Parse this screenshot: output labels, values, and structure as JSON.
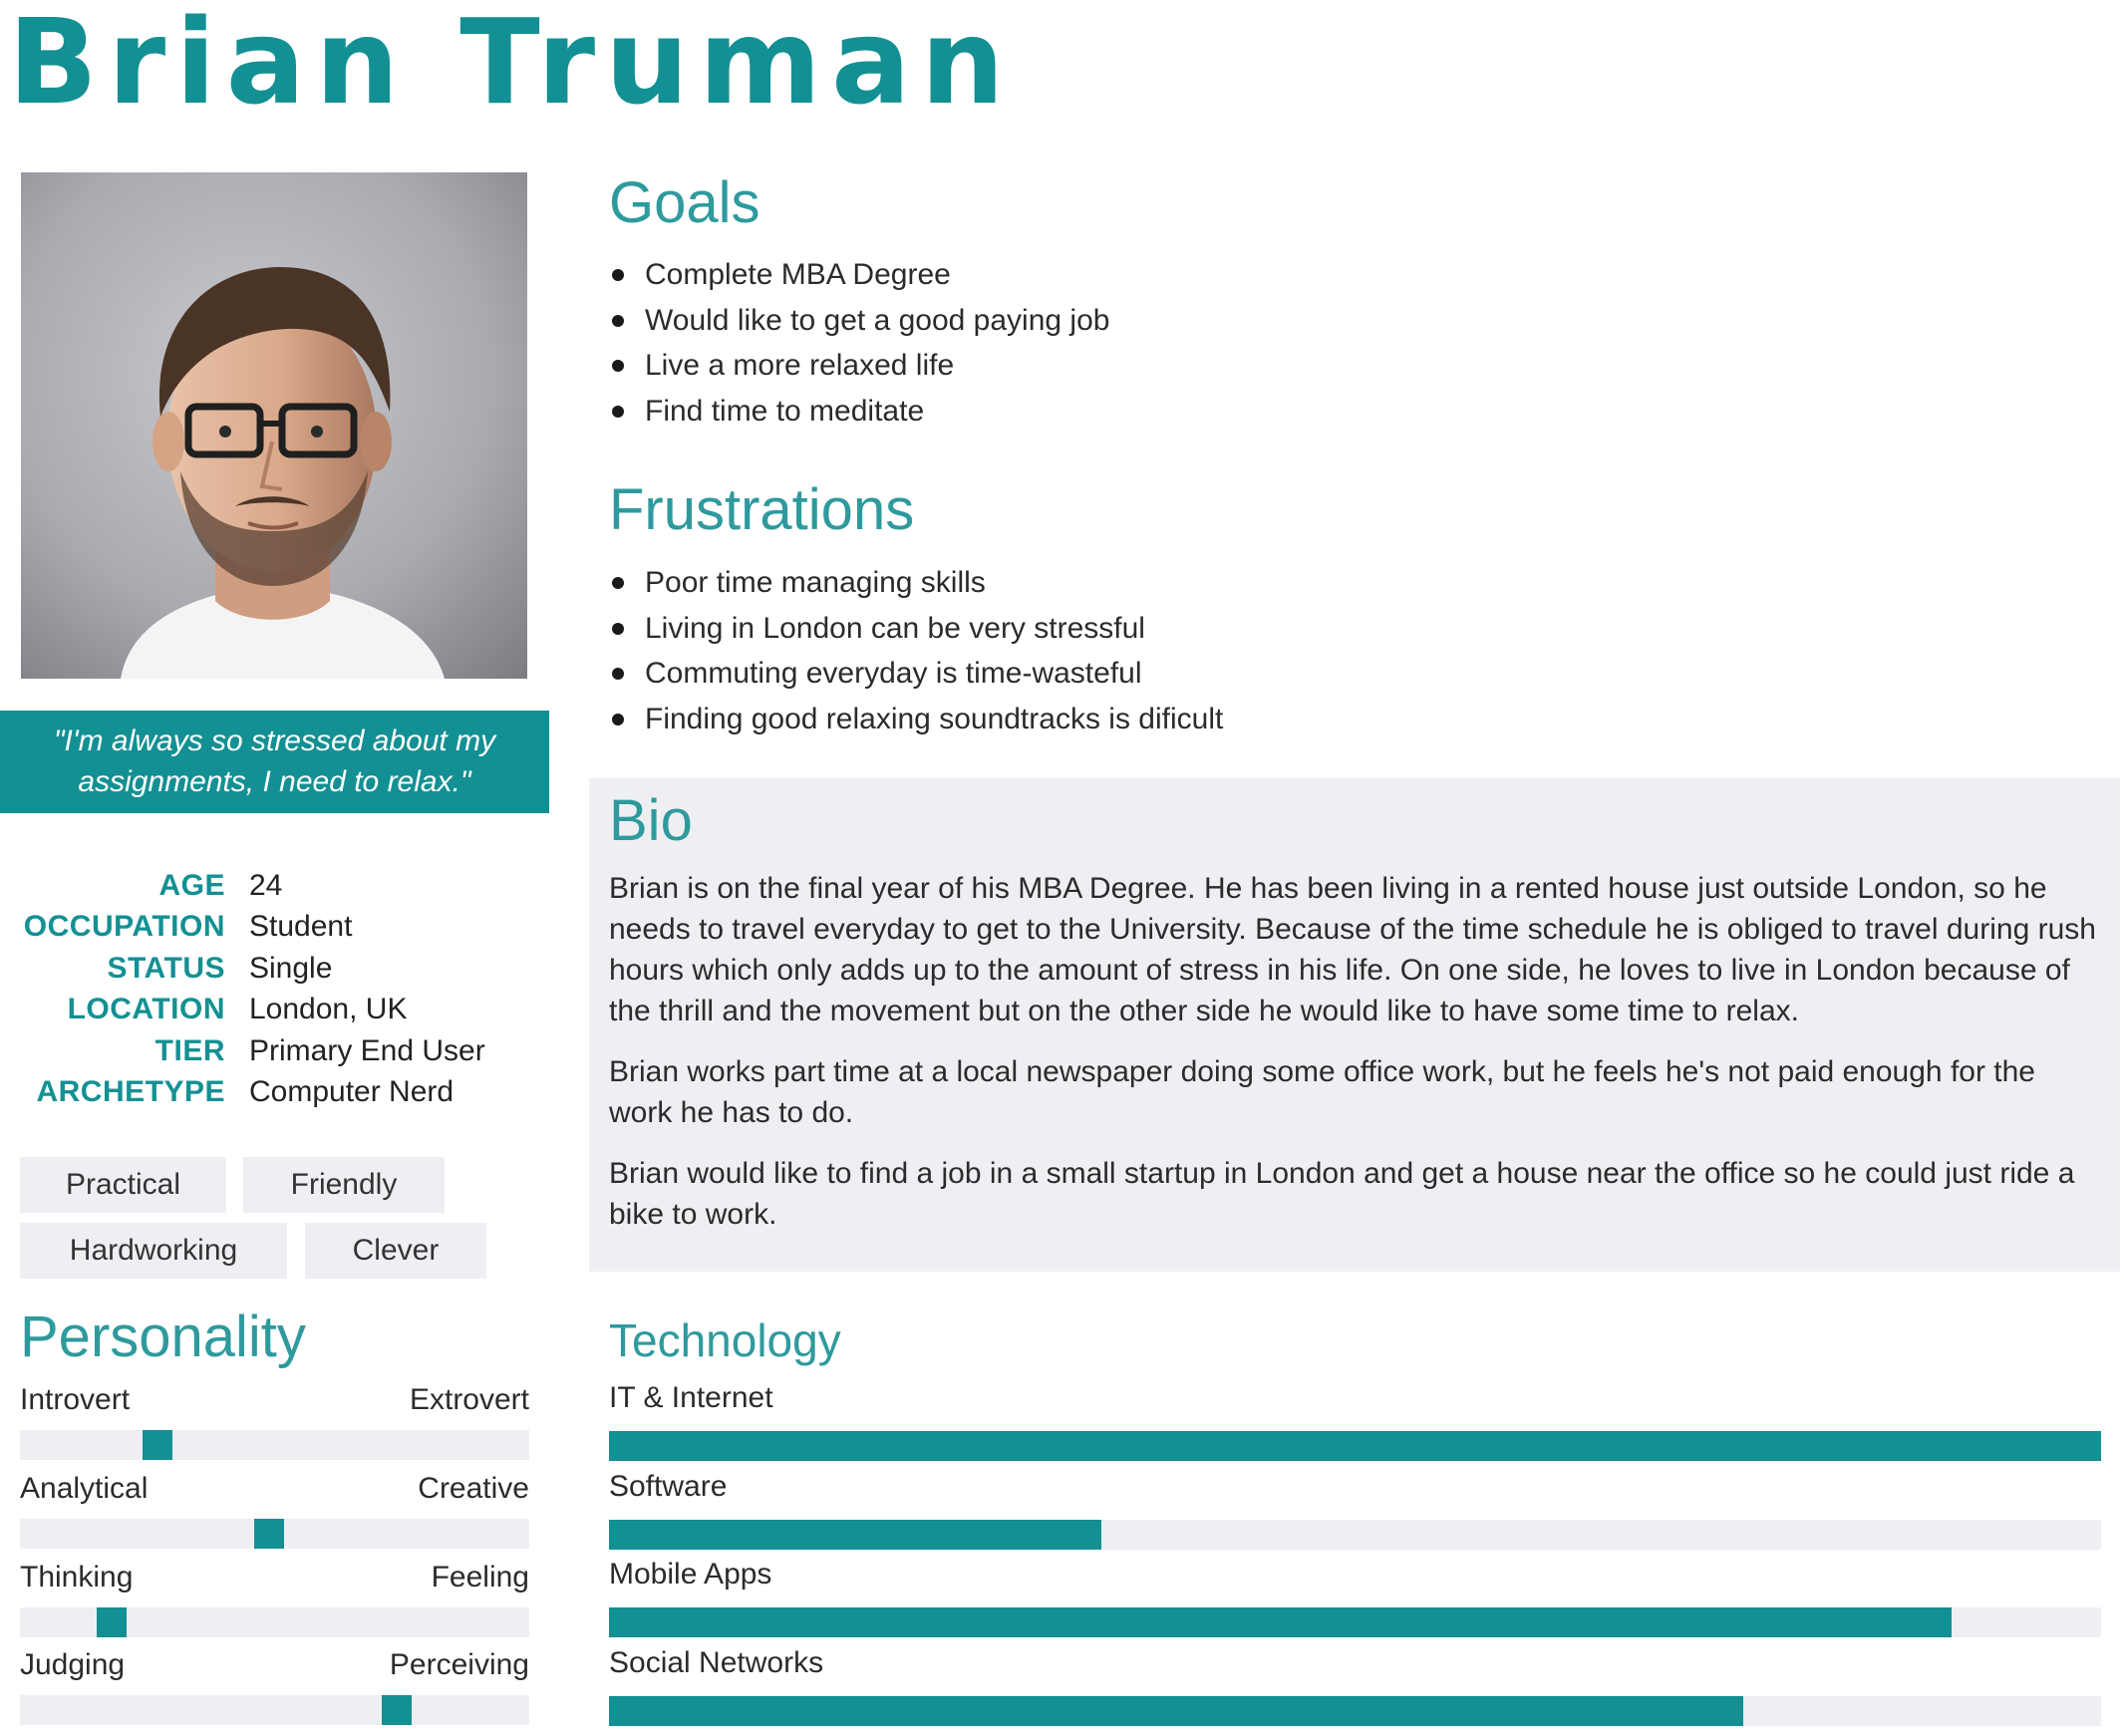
{
  "persona": {
    "name": "Brian Truman",
    "quote": "\"I'm always so stressed about my assignments, I need to relax.\""
  },
  "facts": [
    {
      "label": "AGE",
      "value": "24"
    },
    {
      "label": "OCCUPATION",
      "value": "Student"
    },
    {
      "label": "STATUS",
      "value": "Single"
    },
    {
      "label": "LOCATION",
      "value": "London, UK"
    },
    {
      "label": "TIER",
      "value": "Primary End User"
    },
    {
      "label": "ARCHETYPE",
      "value": "Computer Nerd"
    }
  ],
  "tags": [
    "Practical",
    "Friendly",
    "Hardworking",
    "Clever"
  ],
  "goals": {
    "title": "Goals",
    "items": [
      "Complete MBA Degree",
      "Would like to get a good paying job",
      "Live a more relaxed life",
      "Find time to meditate"
    ]
  },
  "frustrations": {
    "title": "Frustrations",
    "items": [
      "Poor time managing skills",
      "Living in London can be very stressful",
      "Commuting everyday is time-wasteful",
      "Finding good relaxing soundtracks is dificult"
    ]
  },
  "bio": {
    "title": "Bio",
    "paragraphs": [
      "Brian is on the final year of his MBA Degree. He has been living in a rented house just outside London, so he needs to travel everyday to get to the University. Because of the time schedule he is obliged to travel during rush hours which only adds up to the amount of stress in his life. On one side, he loves to live in London because of the thrill and the movement but on the other side he would like to have some time to relax.",
      "Brian works part time at a local newspaper doing some office work, but he feels he's not paid enough for the work he has to do.",
      "Brian would like to find a job in a small startup in London and get a house near the office so he could just ride a bike to work."
    ]
  },
  "personality": {
    "title": "Personality",
    "scales": [
      {
        "left": "Introvert",
        "right": "Extrovert",
        "value": 0.27
      },
      {
        "left": "Analytical",
        "right": "Creative",
        "value": 0.49
      },
      {
        "left": "Thinking",
        "right": "Feeling",
        "value": 0.18
      },
      {
        "left": "Judging",
        "right": "Perceiving",
        "value": 0.74
      }
    ]
  },
  "technology": {
    "title": "Technology",
    "items": [
      {
        "label": "IT & Internet",
        "value": 1.0
      },
      {
        "label": "Software",
        "value": 0.33
      },
      {
        "label": "Mobile Apps",
        "value": 0.9
      },
      {
        "label": "Social Networks",
        "value": 0.76
      }
    ]
  },
  "colors": {
    "accent": "#139093",
    "heading": "#2e9a9d",
    "panel": "#efeff3"
  }
}
